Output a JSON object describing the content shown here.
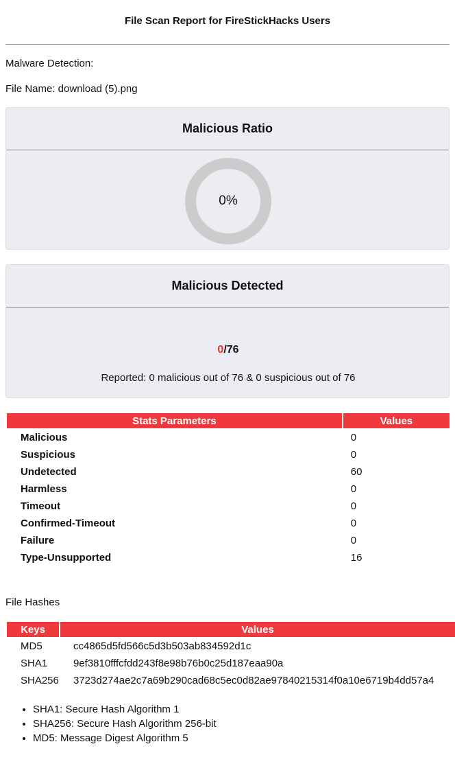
{
  "report": {
    "title": "File Scan Report for FireStickHacks Users"
  },
  "malware_detection": {
    "label": "Malware Detection:",
    "file_name": "File Name: download (5).png"
  },
  "ratio_card": {
    "title": "Malicious Ratio",
    "percent_text": "0%",
    "ratio": 0,
    "ring_color": "#cccccc"
  },
  "detected_card": {
    "title": "Malicious Detected",
    "malicious": "0",
    "total": "/76",
    "reported": "Reported: 0 malicious out of 76 & 0 suspicious out of 76",
    "malicious_color": "#e63535"
  },
  "stats_table": {
    "headers": [
      "Stats Parameters",
      "Values"
    ],
    "rows": [
      {
        "key": "Malicious",
        "value": "0"
      },
      {
        "key": "Suspicious",
        "value": "0"
      },
      {
        "key": "Undetected",
        "value": "60"
      },
      {
        "key": "Harmless",
        "value": "0"
      },
      {
        "key": "Timeout",
        "value": "0"
      },
      {
        "key": "Confirmed-Timeout",
        "value": "0"
      },
      {
        "key": "Failure",
        "value": "0"
      },
      {
        "key": "Type-Unsupported",
        "value": "16"
      }
    ]
  },
  "file_hashes": {
    "label": "File Hashes",
    "headers": [
      "Keys",
      "Values"
    ],
    "rows": [
      {
        "key": "MD5",
        "value": "cc4865d5fd566c5d3b503ab834592d1c"
      },
      {
        "key": "SHA1",
        "value": "9ef3810fffcfdd243f8e98b76b0c25d187eaa90a"
      },
      {
        "key": "SHA256",
        "value": "3723d274ae2c7a69b290cad68c5ec0d82ae97840215314f0a10e6719b4dd57a4"
      }
    ]
  },
  "legend": [
    "SHA1: Secure Hash Algorithm 1",
    "SHA256: Secure Hash Algorithm 256-bit",
    "MD5: Message Digest Algorithm 5"
  ],
  "theme": {
    "accent": "#f0393d",
    "card_bg": "#ecedf2"
  }
}
